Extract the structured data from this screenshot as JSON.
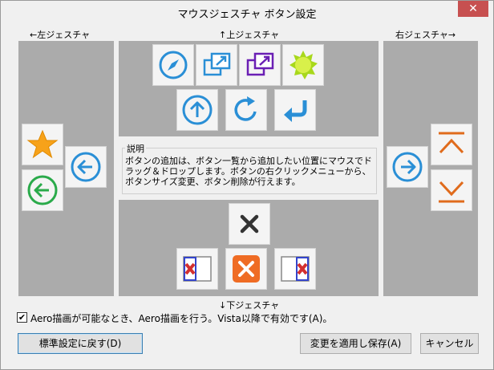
{
  "window": {
    "title": "マウスジェスチャ ボタン設定",
    "close_glyph": "✕"
  },
  "labels": {
    "left": "←左ジェスチャ",
    "up": "↑上ジェスチャ",
    "right": "右ジェスチャ→",
    "down": "↓下ジェスチャ"
  },
  "description": {
    "title": "説明",
    "text": "ボタンの追加は、ボタン一覧から追加したい位置にマウスでドラッグ＆ドロップします。ボタンの右クリックメニューから、ボタンサイズ変更、ボタン削除が行えます。"
  },
  "buttons": {
    "up": [
      "compass-icon",
      "popout-blue-icon",
      "popout-purple-icon",
      "green-sun-icon",
      "arrow-up-circle-icon",
      "reload-icon",
      "return-arrow-icon"
    ],
    "left": [
      "star-icon",
      "arrow-left-circle-blue-icon",
      "arrow-left-circle-green-icon"
    ],
    "right": [
      "arrow-right-circle-icon",
      "chevron-up-orange-icon",
      "chevron-down-orange-icon"
    ],
    "down": [
      "close-x-gray-icon",
      "close-left-panel-icon",
      "close-x-orange-icon",
      "close-right-panel-icon"
    ]
  },
  "checkbox": {
    "checked": true,
    "mark": "✔",
    "label": "Aero描画が可能なとき、Aero描画を行う。Vista以降で有効です(A)。"
  },
  "footer": {
    "reset": "標準設定に戻す(D)",
    "apply": "変更を適用し保存(A)",
    "cancel": "キャンセル"
  },
  "colors": {
    "accent_blue": "#2a8fd6",
    "green": "#2aaa4a",
    "orange": "#e06b1c",
    "purple": "#6a1fb4",
    "red": "#d32f2f",
    "panel_gray": "#ababab"
  }
}
